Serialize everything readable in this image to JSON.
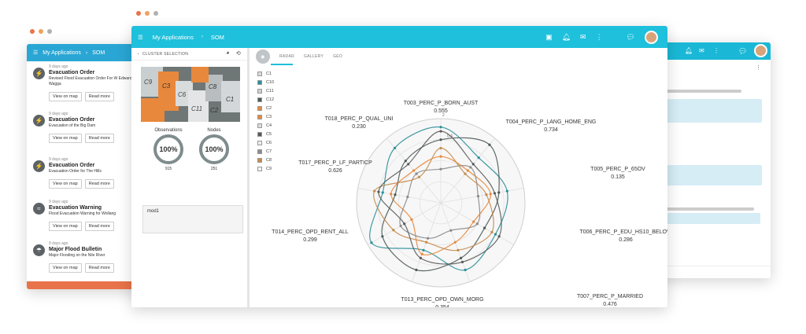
{
  "window_left": {
    "bar_title": "My Applications",
    "bar_crumb": "SOM",
    "items": [
      {
        "time": "9 days ago",
        "title": "Evacuation Order",
        "desc": "Revised Flood Evacuation Order For W Edward St Wagga",
        "btn1": "View on map",
        "btn2": "Read more",
        "icon": "flood-icon"
      },
      {
        "time": "9 days ago",
        "title": "Evacuation Order",
        "desc": "Evacuation of the Big Dam",
        "btn1": "View on map",
        "btn2": "Read more",
        "icon": "flood-icon"
      },
      {
        "time": "9 days ago",
        "title": "Evacuation Order",
        "desc": "Evacuation Order for The Hills",
        "btn1": "View on map",
        "btn2": "Read more",
        "icon": "flood-icon"
      },
      {
        "time": "9 days ago",
        "title": "Evacuation Warning",
        "desc": "Flood Evacuation Warning for Wollang",
        "btn1": "View on map",
        "btn2": "Read more",
        "icon": "wave-icon"
      },
      {
        "time": "9 days ago",
        "title": "Major Flood Bulletin",
        "desc": "Major Flooding on the Nile River",
        "btn1": "View on map",
        "btn2": "Read more",
        "icon": "person-icon"
      }
    ]
  },
  "main": {
    "title": "My Applications",
    "crumb": "SOM",
    "side": {
      "header": "CLUSTER SELECTION",
      "cells": [
        "C9",
        "C3",
        "C6",
        "C11",
        "C2",
        "C8",
        "C1"
      ],
      "observations_label": "Observations",
      "observations_value": "100%",
      "observations_count": "915",
      "nodes_label": "Nodes",
      "nodes_value": "100%",
      "nodes_count": "251",
      "mod_label": "mod1"
    },
    "tabs": [
      "RADAR",
      "GALLERY",
      "GEO"
    ],
    "legend": [
      {
        "name": "C1",
        "color": "#d8dadb"
      },
      {
        "name": "C10",
        "color": "#2b8f99"
      },
      {
        "name": "C11",
        "color": "#d0d0d0"
      },
      {
        "name": "C12",
        "color": "#4c5a58"
      },
      {
        "name": "C2",
        "color": "#e8883c"
      },
      {
        "name": "C3",
        "color": "#e8883c"
      },
      {
        "name": "C4",
        "color": "#dcdcdc"
      },
      {
        "name": "C5",
        "color": "#595959"
      },
      {
        "name": "C6",
        "color": "#eeeeee"
      },
      {
        "name": "C7",
        "color": "#8a8a8a"
      },
      {
        "name": "C8",
        "color": "#c58a4a"
      },
      {
        "name": "C9",
        "color": "#f2f2f2"
      }
    ],
    "radar_axes": [
      {
        "name": "T003_PERC_P_BORN_AUST",
        "value": "0.555"
      },
      {
        "name": "T004_PERC_P_LANG_HOME_ENG",
        "value": "0.734"
      },
      {
        "name": "T005_PERC_P_65OV",
        "value": "0.135"
      },
      {
        "name": "T006_PERC_P_EDU_HS10_BELOW",
        "value": "0.286"
      },
      {
        "name": "T007_PERC_P_MARRIED",
        "value": "0.476"
      },
      {
        "name": "T013_PERC_OPD_OWN_MORG",
        "value": "0.354"
      },
      {
        "name": "T014_PERC_OPD_RENT_ALL",
        "value": "0.299"
      },
      {
        "name": "T017_PERC_P_LF_PARTICP",
        "value": "0.626"
      },
      {
        "name": "T018_PERC_P_QUAL_UNI",
        "value": "0.230"
      }
    ],
    "radar_scale_top": "2",
    "radar_scale_mid": "0.4",
    "series_colors": [
      "#2b8f99",
      "#e8883c",
      "#4c5a58",
      "#8a8a8a",
      "#c58a4a",
      "#595959"
    ],
    "series_profiles": [
      [
        0.9,
        0.7,
        0.8,
        0.75,
        0.85,
        0.6,
        0.95,
        0.7,
        0.85
      ],
      [
        0.55,
        0.5,
        0.6,
        0.45,
        0.5,
        0.65,
        0.4,
        0.6,
        0.5
      ],
      [
        0.75,
        0.9,
        0.7,
        0.6,
        0.7,
        0.85,
        0.8,
        0.55,
        0.65
      ],
      [
        0.4,
        0.55,
        0.45,
        0.5,
        0.35,
        0.45,
        0.55,
        0.4,
        0.45
      ],
      [
        0.65,
        0.45,
        0.55,
        0.7,
        0.6,
        0.5,
        0.65,
        0.8,
        0.4
      ],
      [
        0.85,
        0.6,
        0.65,
        0.8,
        0.75,
        0.7,
        0.5,
        0.75,
        0.6
      ]
    ]
  }
}
